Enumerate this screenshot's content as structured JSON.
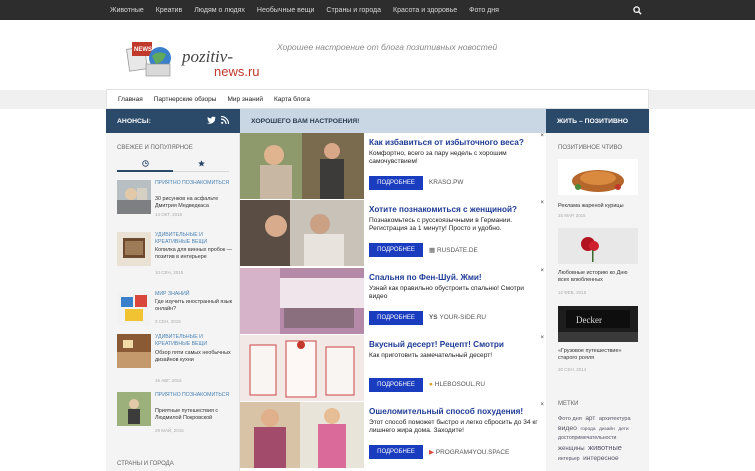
{
  "topnav": {
    "items": [
      "Животные",
      "Креатив",
      "Людям о людях",
      "Необычные вещи",
      "Страны и города",
      "Красота и здоровье",
      "Фото дня"
    ],
    "search_icon": "search-icon"
  },
  "header": {
    "logo_text": "pozitiv-news.ru",
    "tagline": "Хорошее настроение от блога позитивных новостей"
  },
  "subnav": {
    "items": [
      "Главная",
      "Партнерские обзоры",
      "Мир знаний",
      "Карта блога"
    ]
  },
  "left": {
    "header": "АНОНСЫ:",
    "section_title": "СВЕЖЕЕ И ПОПУЛЯРНОЕ",
    "posts": [
      {
        "category": "ПРИЯТНО ПОЗНАКОМИТЬСЯ",
        "title": "30 рисунков на асфальте Дмитрия Медведкаса",
        "date": "14 ОКТ, 2015"
      },
      {
        "category": "УДИВИТЕЛЬНЫЕ И КРЕАТИВНЫЕ ВЕЩИ",
        "title": "Копилка для винных пробок — позитив в интерьере",
        "date": "10 СЕН, 2015"
      },
      {
        "category": "МИР ЗНАНИЙ",
        "title": "Где изучить иностранный язык онлайн?",
        "date": "3 СЕН, 2015"
      },
      {
        "category": "УДИВИТЕЛЬНЫЕ И КРЕАТИВНЫЕ ВЕЩИ",
        "title": "Обзор пяти самых необычных дизайнов кухни",
        "date": "16 АВГ, 2015"
      },
      {
        "category": "ПРИЯТНО ПОЗНАКОМИТЬСЯ",
        "title": "Приятные путешествия с Людмилой Покровской",
        "date": "29 МАЙ, 2015"
      }
    ],
    "next_section": "СТРАНЫ И ГОРОДА"
  },
  "middle": {
    "header": "ХОРОШЕГО ВАМ НАСТРОЕНИЯ!",
    "ads": [
      {
        "title": "Как избавиться от избыточного веса?",
        "desc": "Комфортно, всего за пару недель с хорошим самочувствием!",
        "button": "ПОДРОБНЕЕ",
        "site": "KRASO.PW"
      },
      {
        "title": "Хотите познакомиться с женщиной?",
        "desc": "Познакомьтесь с русскоязычными в Германии. Регистрация за 1 минуту! Просто и удобно.",
        "button": "ПОДРОБНЕЕ",
        "site": "RUSDATE.DE"
      },
      {
        "title": "Спальня по Фен-Шуй. Жми!",
        "desc": "Узнай как правильно обустроить спальню! Смотри видео",
        "button": "ПОДРОБНЕЕ",
        "site": "YOUR-SIDE.RU"
      },
      {
        "title": "Вкусный десерт! Рецепт! Смотри",
        "desc": "Как приготовить замечательный десерт!",
        "button": "ПОДРОБНЕЕ",
        "site": "HLEBOSOUL.RU"
      },
      {
        "title": "Ошеломительный способ похудения!",
        "desc": "Этот способ поможет быстро и легко сбросить до 34 кг лишнего жира дома. Заходите!",
        "button": "ПОДРОБНЕЕ",
        "site": "PROGRAM4YOU.SPACE"
      }
    ]
  },
  "right": {
    "header": "ЖИТЬ – ПОЗИТИВНО",
    "section_title": "ПОЗИТИВНОЕ ЧТИВО",
    "posts": [
      {
        "caption": "Реклама жареной курицы",
        "date": "25 МАР, 2015"
      },
      {
        "caption": "Любовные историю ко Дню всех влюбленных",
        "date": "12 ФЕВ, 2015"
      },
      {
        "caption": "«Грузовое путешествие» старого рояля",
        "date": "20 СЕН, 2014"
      }
    ],
    "tags_title": "МЕТКИ",
    "tags": [
      "Фото дня",
      "арт",
      "архитектура",
      "видео",
      "города",
      "дизайн",
      "дети",
      "достопримечательности",
      "женщины",
      "животные",
      "интерьер",
      "интересное"
    ]
  },
  "colors": {
    "accent": "#2b4a6a",
    "ad_button": "#1a3cbf",
    "ad_title": "#1f3b95",
    "topbar": "#2d2d2d"
  }
}
